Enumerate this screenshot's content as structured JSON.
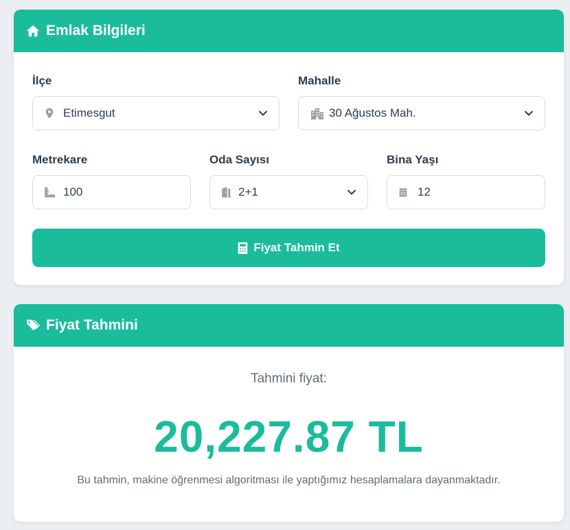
{
  "form_card": {
    "title": "Emlak Bilgileri",
    "header_icon": "home-icon",
    "ilce": {
      "label": "İlçe",
      "value": "Etimesgut",
      "icon": "map-marker-icon"
    },
    "mahalle": {
      "label": "Mahalle",
      "value": "30 Ağustos Mah.",
      "icon": "building-icon"
    },
    "metrekare": {
      "label": "Metrekare",
      "value": "100",
      "icon": "ruler-icon"
    },
    "oda_sayisi": {
      "label": "Oda Sayısı",
      "value": "2+1",
      "icon": "door-icon"
    },
    "bina_yasi": {
      "label": "Bina Yaşı",
      "value": "12",
      "icon": "calendar-icon"
    },
    "submit_label": "Fiyat Tahmin Et",
    "submit_icon": "calculator-icon"
  },
  "result_card": {
    "title": "Fiyat Tahmini",
    "header_icon": "tags-icon",
    "label": "Tahmini fiyat:",
    "value": "20,227.87 TL",
    "note": "Bu tahmin, makine öğrenmesi algoritması ile yaptığımız hesaplamalara dayanmaktadır."
  },
  "colors": {
    "accent": "#1abc9c",
    "background": "#eceff1",
    "text": "#2c3e50",
    "muted": "#5f6b76"
  }
}
